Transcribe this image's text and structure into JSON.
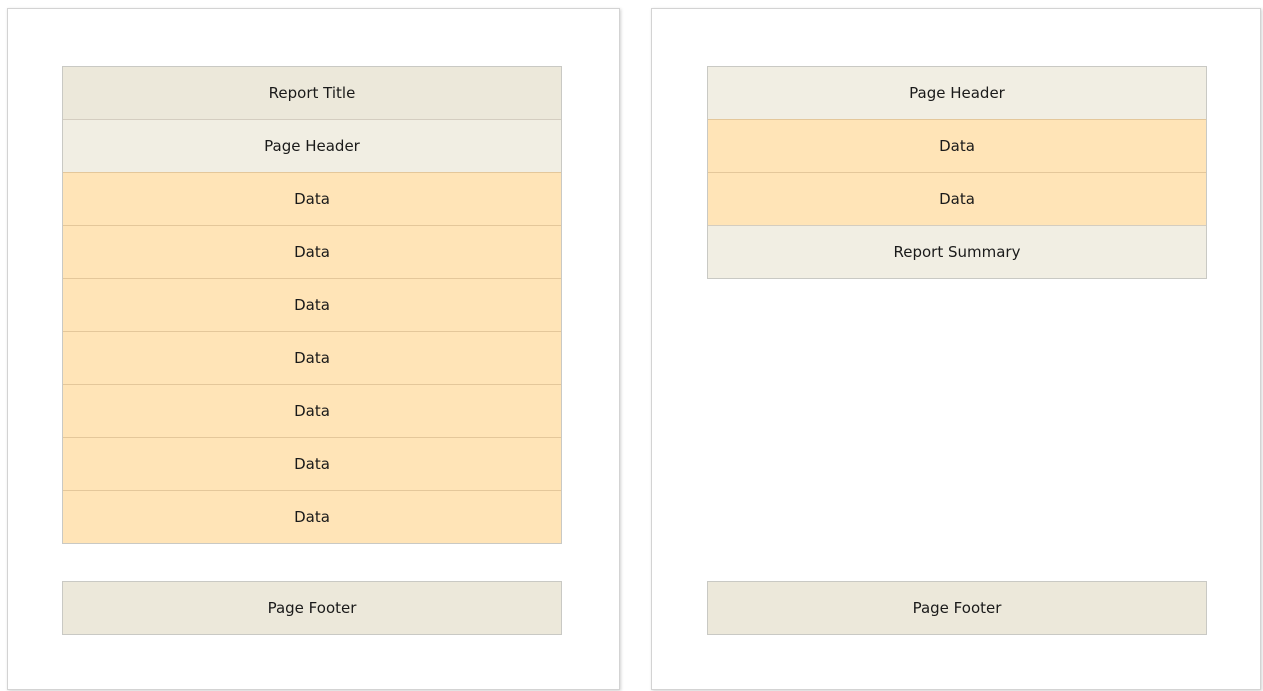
{
  "pages": [
    {
      "bands": [
        {
          "type": "title",
          "label": "Report Title"
        },
        {
          "type": "header",
          "label": "Page Header"
        },
        {
          "type": "data",
          "label": "Data"
        },
        {
          "type": "data",
          "label": "Data"
        },
        {
          "type": "data",
          "label": "Data"
        },
        {
          "type": "data",
          "label": "Data"
        },
        {
          "type": "data",
          "label": "Data"
        },
        {
          "type": "data",
          "label": "Data"
        },
        {
          "type": "data",
          "label": "Data"
        }
      ],
      "footer": "Page Footer"
    },
    {
      "bands": [
        {
          "type": "header",
          "label": "Page Header"
        },
        {
          "type": "data",
          "label": "Data"
        },
        {
          "type": "data",
          "label": "Data"
        },
        {
          "type": "summary",
          "label": "Report Summary"
        }
      ],
      "footer": "Page Footer"
    }
  ],
  "colors": {
    "title_band": "#ece8da",
    "header_band": "#f1eee3",
    "data_band": "#ffe4b7",
    "summary_band": "#f1eee3",
    "footer_band": "#ece8da",
    "band_border": "#c9c9c4"
  }
}
